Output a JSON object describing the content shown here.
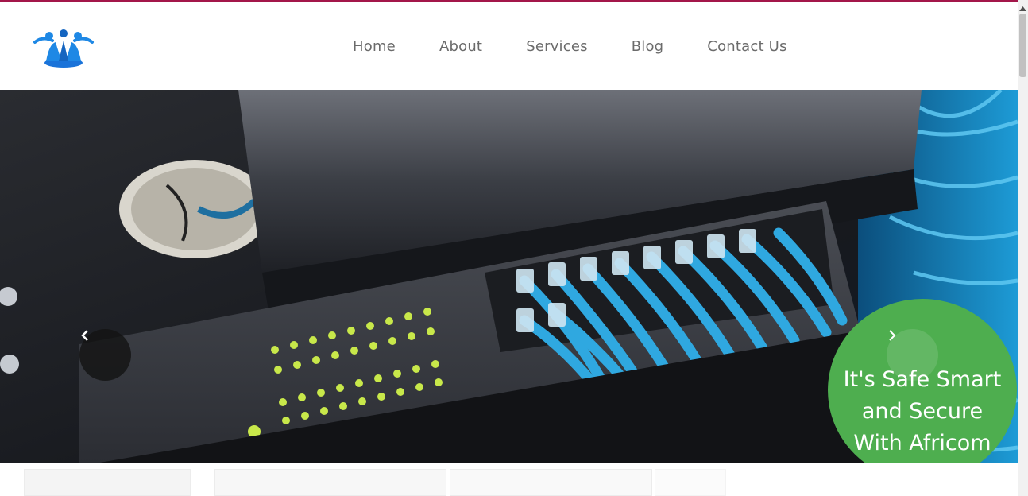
{
  "brand": {
    "logo_icon": "people-arch-logo",
    "accent": "#a3174a",
    "logo_color": "#1e88e5"
  },
  "nav": {
    "items": [
      {
        "label": "Home"
      },
      {
        "label": "About"
      },
      {
        "label": "Services"
      },
      {
        "label": "Blog"
      },
      {
        "label": "Contact Us"
      }
    ]
  },
  "hero": {
    "image": "network-switch-with-blue-cables",
    "caption": "It's Safe Smart and Secure With Africom",
    "caption_bg": "#4eae4f",
    "prev_icon": "chevron-left-icon",
    "next_icon": "chevron-right-icon"
  }
}
